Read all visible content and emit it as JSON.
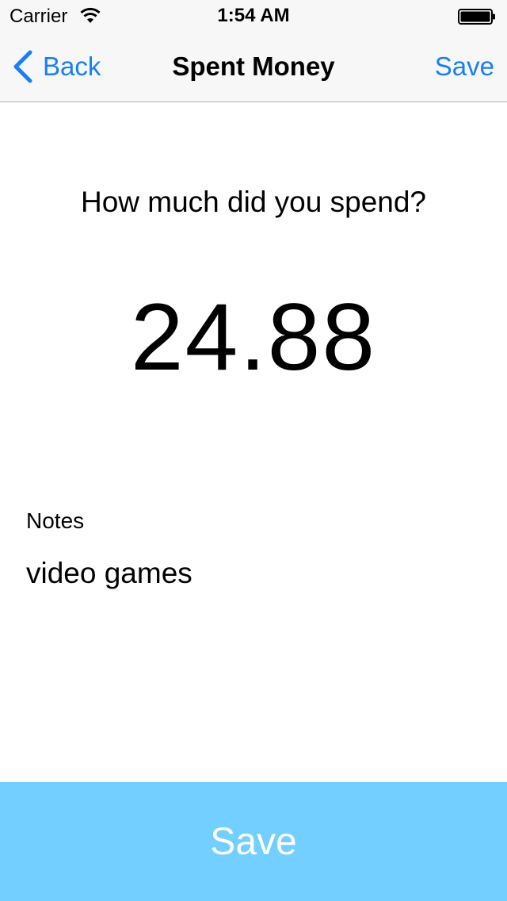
{
  "status_bar": {
    "carrier": "Carrier",
    "time": "1:54 AM",
    "wifi_icon": "wifi-icon",
    "battery_icon": "battery-icon"
  },
  "nav_bar": {
    "back_label": "Back",
    "back_icon": "chevron-left-icon",
    "title": "Spent Money",
    "save_label": "Save",
    "accent_color": "#1a7ff5"
  },
  "main": {
    "question": "How much did you spend?",
    "amount": "24.88",
    "notes_label": "Notes",
    "notes_value": "video games"
  },
  "footer": {
    "save_label": "Save",
    "button_color": "#72cfff"
  }
}
